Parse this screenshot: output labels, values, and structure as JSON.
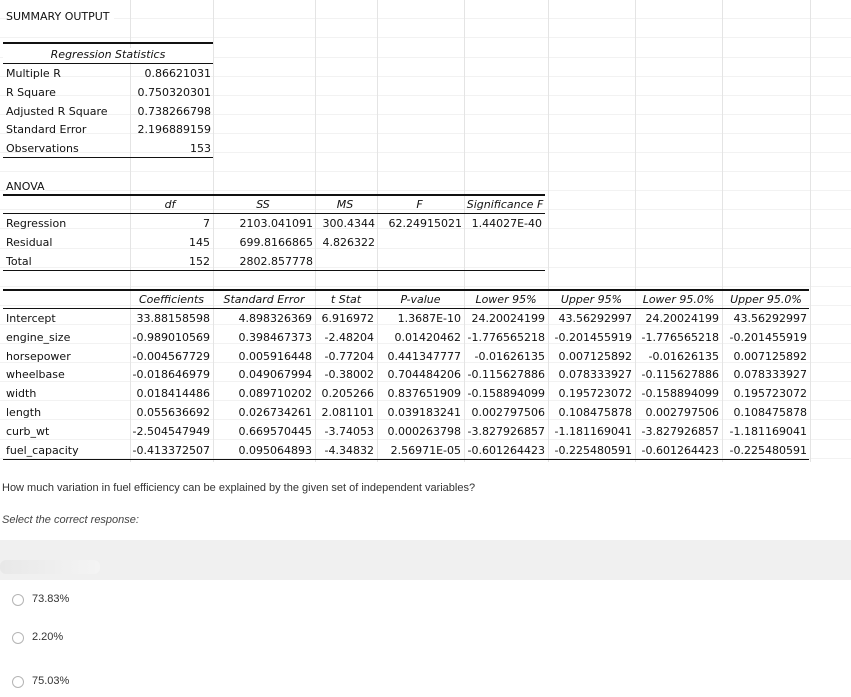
{
  "summary_title": "SUMMARY OUTPUT",
  "regression_statistics": {
    "header": "Regression Statistics",
    "rows": [
      {
        "label": "Multiple R",
        "value": "0.86621031"
      },
      {
        "label": "R Square",
        "value": "0.750320301"
      },
      {
        "label": "Adjusted R Square",
        "value": "0.738266798"
      },
      {
        "label": "Standard Error",
        "value": "2.196889159"
      },
      {
        "label": "Observations",
        "value": "153"
      }
    ]
  },
  "anova": {
    "title": "ANOVA",
    "headers": [
      "df",
      "SS",
      "MS",
      "F",
      "Significance F"
    ],
    "rows": [
      {
        "label": "Regression",
        "df": "7",
        "ss": "2103.041091",
        "ms": "300.4344",
        "f": "62.24915021",
        "sig": "1.44027E-40"
      },
      {
        "label": "Residual",
        "df": "145",
        "ss": "699.8166865",
        "ms": "4.826322",
        "f": "",
        "sig": ""
      },
      {
        "label": "Total",
        "df": "152",
        "ss": "2802.857778",
        "ms": "",
        "f": "",
        "sig": ""
      }
    ]
  },
  "coefficients": {
    "headers": [
      "Coefficients",
      "Standard Error",
      "t Stat",
      "P-value",
      "Lower 95%",
      "Upper 95%",
      "Lower 95.0%",
      "Upper 95.0%"
    ],
    "rows": [
      {
        "label": "Intercept",
        "vals": [
          "33.88158598",
          "4.898326369",
          "6.916972",
          "1.3687E-10",
          "24.20024199",
          "43.56292997",
          "24.20024199",
          "43.56292997"
        ]
      },
      {
        "label": "engine_size",
        "vals": [
          "-0.989010569",
          "0.398467373",
          "-2.48204",
          "0.01420462",
          "-1.776565218",
          "-0.201455919",
          "-1.776565218",
          "-0.201455919"
        ]
      },
      {
        "label": "horsepower",
        "vals": [
          "-0.004567729",
          "0.005916448",
          "-0.77204",
          "0.441347777",
          "-0.01626135",
          "0.007125892",
          "-0.01626135",
          "0.007125892"
        ]
      },
      {
        "label": "wheelbase",
        "vals": [
          "-0.018646979",
          "0.049067994",
          "-0.38002",
          "0.704484206",
          "-0.115627886",
          "0.078333927",
          "-0.115627886",
          "0.078333927"
        ]
      },
      {
        "label": "width",
        "vals": [
          "0.018414486",
          "0.089710202",
          "0.205266",
          "0.837651909",
          "-0.158894099",
          "0.195723072",
          "-0.158894099",
          "0.195723072"
        ]
      },
      {
        "label": "length",
        "vals": [
          "0.055636692",
          "0.026734261",
          "2.081101",
          "0.039183241",
          "0.002797506",
          "0.108475878",
          "0.002797506",
          "0.108475878"
        ]
      },
      {
        "label": "curb_wt",
        "vals": [
          "-2.504547949",
          "0.669570445",
          "-3.74053",
          "0.000263798",
          "-3.827926857",
          "-1.181169041",
          "-3.827926857",
          "-1.181169041"
        ]
      },
      {
        "label": "fuel_capacity",
        "vals": [
          "-0.413372507",
          "0.095064893",
          "-4.34832",
          "2.56971E-05",
          "-0.601264423",
          "-0.225480591",
          "-0.601264423",
          "-0.225480591"
        ]
      }
    ]
  },
  "question": {
    "text": "How much variation in fuel efficiency can be explained by the given set of independent variables?",
    "instruction": "Select the correct response:",
    "options": [
      "73.83%",
      "2.20%",
      "75.03%"
    ]
  }
}
